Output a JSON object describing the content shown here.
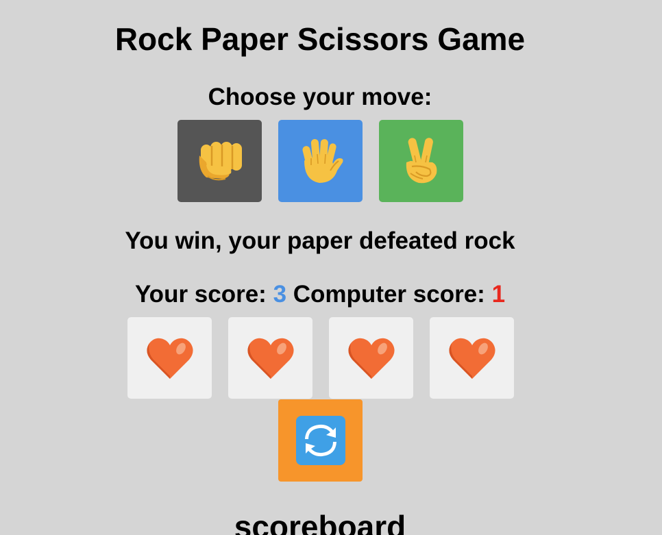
{
  "title": "Rock Paper Scissors Game",
  "prompt": "Choose your move:",
  "moves": [
    {
      "name": "rock",
      "icon": "fist-icon",
      "color": "#555555"
    },
    {
      "name": "paper",
      "icon": "open-hand-icon",
      "color": "#4a90e2"
    },
    {
      "name": "scissors",
      "icon": "victory-hand-icon",
      "color": "#5ab35a"
    }
  ],
  "result": "You win, your paper defeated rock",
  "score": {
    "player_label": "Your score:",
    "player_value": "3",
    "computer_label": "Computer score:",
    "computer_value": "1",
    "player_color": "#4a90e2",
    "computer_color": "#e8281e"
  },
  "lives": {
    "count": 4,
    "icon": "heart-icon",
    "color": "#f26c35"
  },
  "reset": {
    "icon": "refresh-icon",
    "color": "#f7952b"
  },
  "scoreboard_heading": "scoreboard"
}
